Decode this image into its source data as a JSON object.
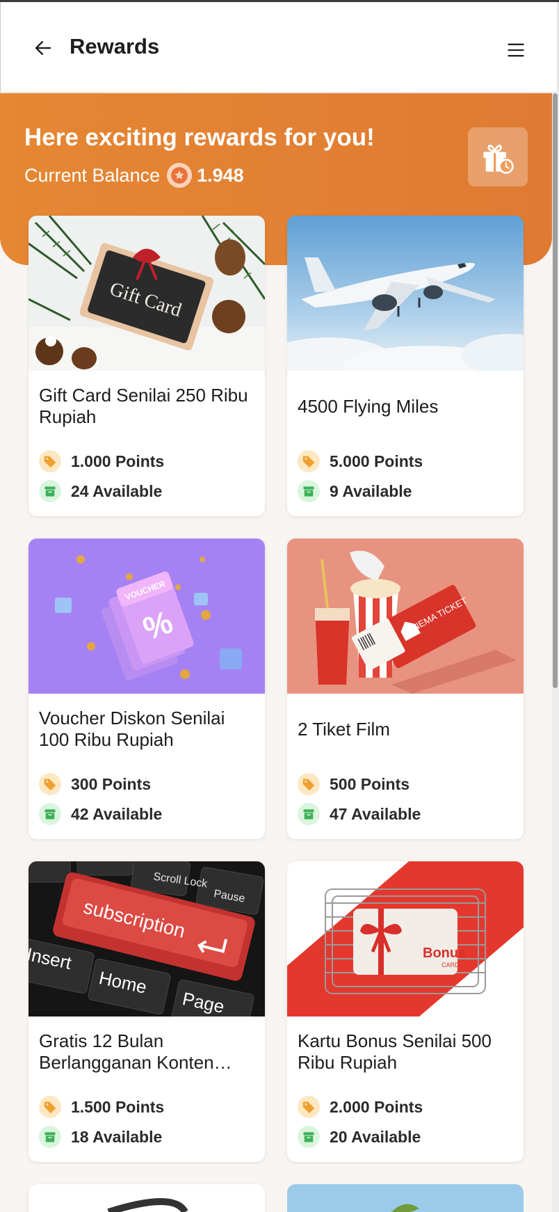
{
  "header": {
    "title": "Rewards"
  },
  "hero": {
    "headline": "Here exciting rewards for you!",
    "balance_label": "Current Balance",
    "balance_value": "1.948"
  },
  "colors": {
    "accent": "#E3812F",
    "points_badge": "#F0A030",
    "available_badge": "#3DAF5A"
  },
  "rewards": [
    {
      "title": "Gift Card Senilai 250 Ribu Rupiah",
      "points": "1.000 Points",
      "available": "24 Available",
      "image_text": "Gift Card"
    },
    {
      "title": "4500 Flying Miles",
      "points": "5.000 Points",
      "available": "9 Available"
    },
    {
      "title": "Voucher Diskon Senilai 100 Ribu Rupiah",
      "points": "300 Points",
      "available": "42 Available",
      "image_text": "VOUCHER"
    },
    {
      "title": "2 Tiket Film",
      "points": "500 Points",
      "available": "47 Available",
      "image_text": "CINEMA TICKET"
    },
    {
      "title": "Gratis 12 Bulan Berlangganan Konten…",
      "points": "1.500 Points",
      "available": "18 Available",
      "image_text": "subscription",
      "image_keys": [
        "Scroll Lock",
        "Pause",
        "Insert",
        "Home",
        "Page"
      ]
    },
    {
      "title": "Kartu Bonus Senilai 500 Ribu Rupiah",
      "points": "2.000 Points",
      "available": "20 Available",
      "image_text": "Bonus",
      "image_subtext": "CARD"
    }
  ]
}
